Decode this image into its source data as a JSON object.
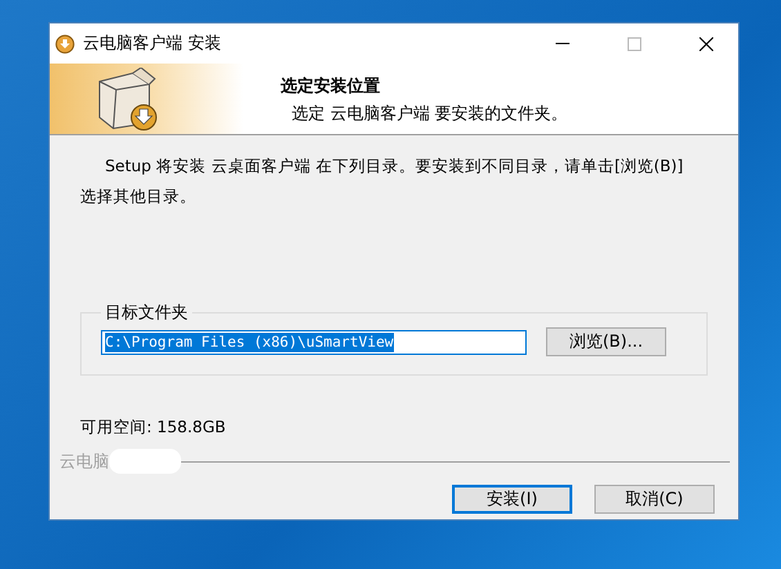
{
  "window": {
    "title": "云电脑客户端 安装"
  },
  "header": {
    "title": "选定安装位置",
    "subtitle": "选定 云电脑客户端 要安装的文件夹。"
  },
  "body": {
    "intro": "Setup 将安装 云桌面客户端 在下列目录。要安装到不同目录，请单击[浏览(B)]",
    "intro_2": "选择其他目录。"
  },
  "target_folder": {
    "label": "目标文件夹",
    "value": "C:\\Program Files (x86)\\uSmartView",
    "browse_button": "浏览(B)..."
  },
  "space": {
    "label": "可用空间: 158.8GB"
  },
  "brand": {
    "text": "云电脑"
  },
  "buttons": [
    {
      "label": "安装(I)",
      "selected": true
    },
    {
      "label": "取消(C)",
      "selected": false
    }
  ]
}
